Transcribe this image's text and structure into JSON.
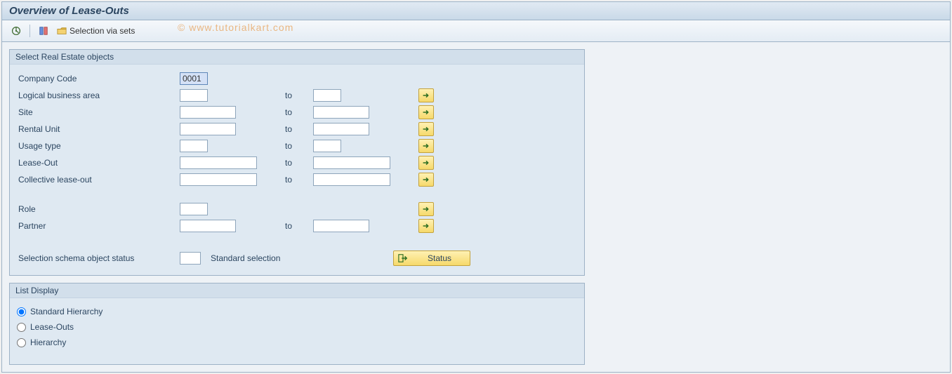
{
  "title": "Overview of Lease-Outs",
  "watermark": "© www.tutorialkart.com",
  "toolbar": {
    "selection_via_sets": "Selection via sets"
  },
  "group1": {
    "title": "Select Real Estate objects",
    "rows": {
      "company_code": {
        "label": "Company Code",
        "from": "0001"
      },
      "logical_ba": {
        "label": "Logical business area",
        "from": "",
        "to_label": "to",
        "to": ""
      },
      "site": {
        "label": "Site",
        "from": "",
        "to_label": "to",
        "to": ""
      },
      "rental_unit": {
        "label": "Rental Unit",
        "from": "",
        "to_label": "to",
        "to": ""
      },
      "usage_type": {
        "label": "Usage type",
        "from": "",
        "to_label": "to",
        "to": ""
      },
      "lease_out": {
        "label": "Lease-Out",
        "from": "",
        "to_label": "to",
        "to": ""
      },
      "collective": {
        "label": "Collective lease-out",
        "from": "",
        "to_label": "to",
        "to": ""
      },
      "role": {
        "label": "Role",
        "from": ""
      },
      "partner": {
        "label": "Partner",
        "from": "",
        "to_label": "to",
        "to": ""
      }
    },
    "status_row": {
      "label": "Selection schema object status",
      "value": "",
      "std_label": "Standard selection",
      "button_label": "Status"
    }
  },
  "group2": {
    "title": "List Display",
    "options": {
      "standard_hierarchy": "Standard Hierarchy",
      "lease_outs": "Lease-Outs",
      "hierarchy": "Hierarchy"
    },
    "selected": "standard_hierarchy"
  }
}
